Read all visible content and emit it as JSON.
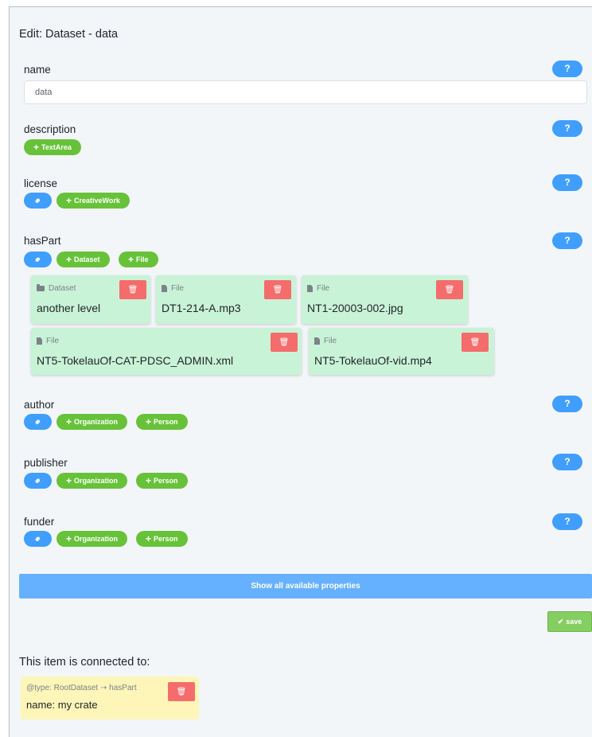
{
  "page": {
    "title": "Edit: Dataset - data"
  },
  "help_label": "?",
  "properties": {
    "name": {
      "label": "name",
      "value": "data"
    },
    "description": {
      "label": "description",
      "add": [
        "TextArea"
      ]
    },
    "license": {
      "label": "license",
      "add": [
        "CreativeWork"
      ]
    },
    "hasPart": {
      "label": "hasPart",
      "add": [
        "Dataset",
        "File"
      ]
    },
    "author": {
      "label": "author",
      "add": [
        "Organization",
        "Person"
      ]
    },
    "publisher": {
      "label": "publisher",
      "add": [
        "Organization",
        "Person"
      ]
    },
    "funder": {
      "label": "funder",
      "add": [
        "Organization",
        "Person"
      ]
    }
  },
  "hasPart_items": [
    {
      "type": "Dataset",
      "name": "another level"
    },
    {
      "type": "File",
      "name": "DT1-214-A.mp3"
    },
    {
      "type": "File",
      "name": "NT1-20003-002.jpg"
    },
    {
      "type": "File",
      "name": "NT5-TokelauOf-CAT-PDSC_ADMIN.xml"
    },
    {
      "type": "File",
      "name": "NT5-TokelauOf-vid.mp4"
    }
  ],
  "show_all_label": "Show all available properties",
  "save_label": "save",
  "connections": {
    "title": "This item is connected to:",
    "items": [
      {
        "type_text": "@type: RootDataset",
        "property": "hasPart",
        "name": "name: my crate"
      }
    ]
  },
  "colors": {
    "primary": "#409eff",
    "success": "#67c23a",
    "danger": "#f56c6c",
    "card_green": "#c9f3d6",
    "card_yellow": "#fdf6b8"
  }
}
